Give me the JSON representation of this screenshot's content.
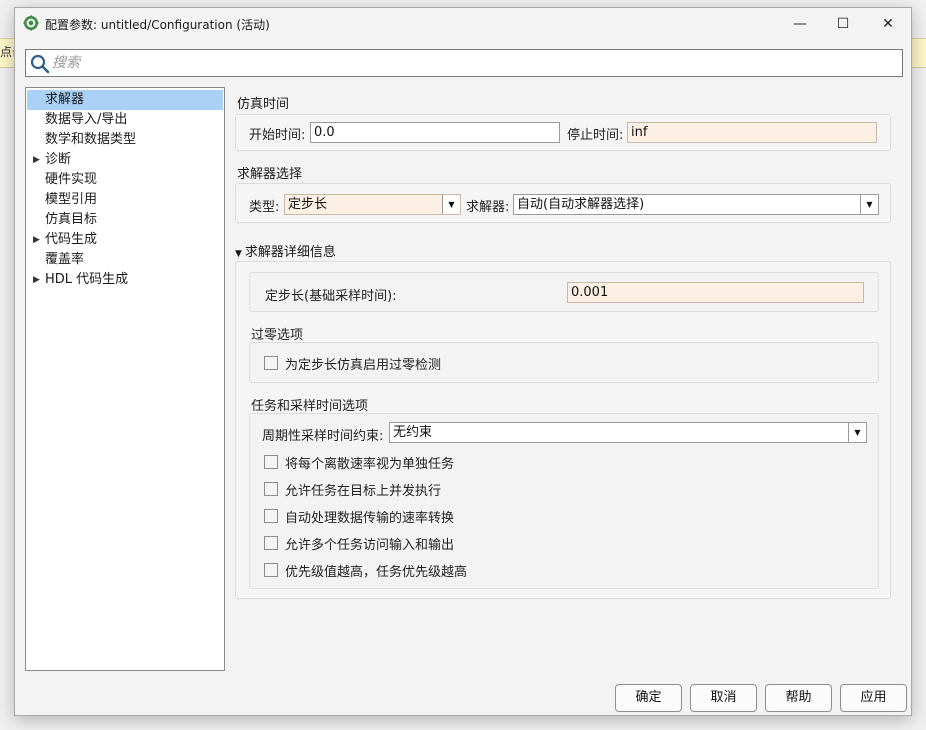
{
  "background": {
    "hint_text": "点击"
  },
  "titlebar": {
    "title": "配置参数: untitled/Configuration (活动)",
    "minimize": "—",
    "maximize": "☐",
    "close": "✕"
  },
  "search": {
    "placeholder": "搜索"
  },
  "tree": {
    "items": [
      {
        "label": "求解器",
        "expandable": false,
        "selected": true
      },
      {
        "label": "数据导入/导出",
        "expandable": false
      },
      {
        "label": "数学和数据类型",
        "expandable": false
      },
      {
        "label": "诊断",
        "expandable": true
      },
      {
        "label": "硬件实现",
        "expandable": false
      },
      {
        "label": "模型引用",
        "expandable": false
      },
      {
        "label": "仿真目标",
        "expandable": false
      },
      {
        "label": "代码生成",
        "expandable": true
      },
      {
        "label": "覆盖率",
        "expandable": false
      },
      {
        "label": "HDL 代码生成",
        "expandable": true
      }
    ]
  },
  "sim_time": {
    "title": "仿真时间",
    "start_label": "开始时间:",
    "start_value": "0.0",
    "stop_label": "停止时间:",
    "stop_value": "inf"
  },
  "solver_select": {
    "title": "求解器选择",
    "type_label": "类型:",
    "type_value": "定步长",
    "solver_label": "求解器:",
    "solver_value": "自动(自动求解器选择)"
  },
  "solver_details": {
    "title": "求解器详细信息",
    "expand_glyph": "▼",
    "fixed_step_label": "定步长(基础采样时间):",
    "fixed_step_value": "0.001",
    "zero_crossing": {
      "title": "过零选项",
      "checkbox_label": "为定步长仿真启用过零检测"
    },
    "tasking": {
      "title": "任务和采样时间选项",
      "periodic_label": "周期性采样时间约束:",
      "periodic_value": "无约束",
      "checkboxes": [
        "将每个离散速率视为单独任务",
        "允许任务在目标上并发执行",
        "自动处理数据传输的速率转换",
        "允许多个任务访问输入和输出",
        "优先级值越高，任务优先级越高"
      ]
    }
  },
  "buttons": {
    "ok": "确定",
    "cancel": "取消",
    "help": "帮助",
    "apply": "应用"
  },
  "colors": {
    "selection": "#a9d1f5",
    "tinted_field": "#fcefe3",
    "dialog_bg": "#f3f3f3"
  }
}
